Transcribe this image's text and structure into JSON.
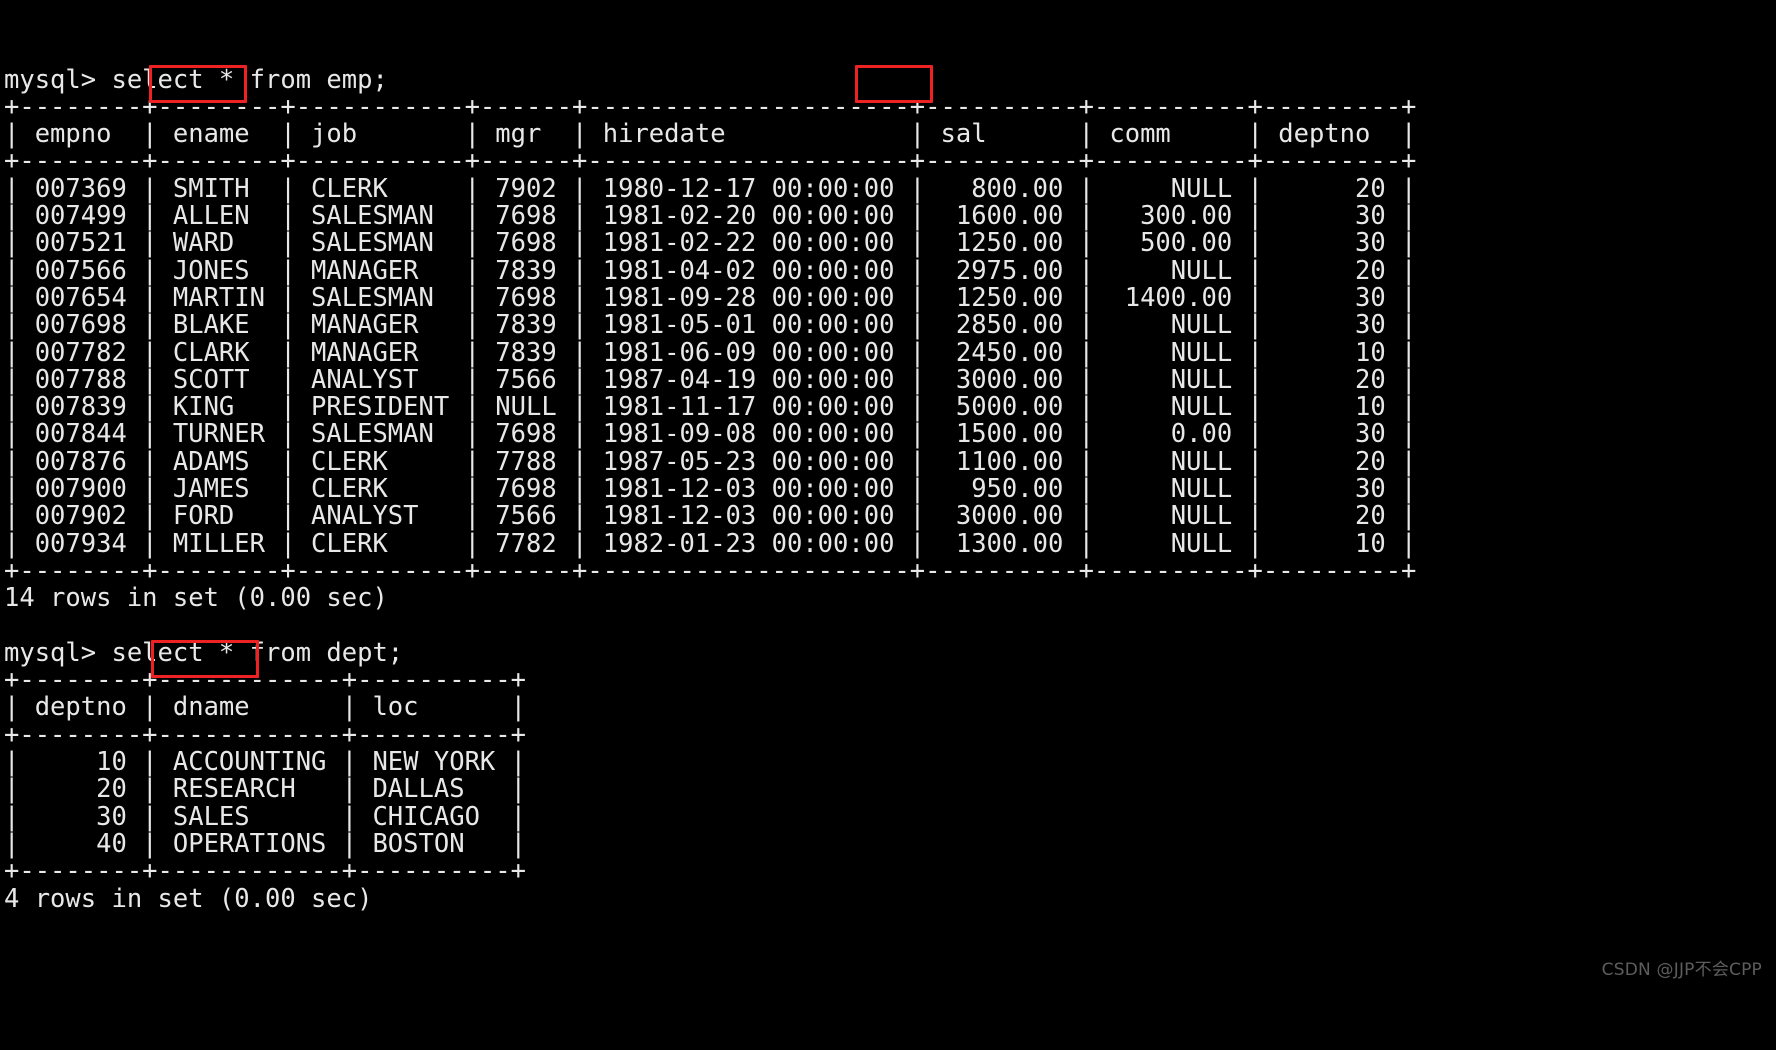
{
  "terminal": {
    "prompt": "mysql>",
    "colors": {
      "background": "#000000",
      "foreground": "#e8e8e8",
      "highlight_box": "#ee2222",
      "watermark": "#5d5d5d"
    }
  },
  "watermark": "CSDN @JJP不会CPP",
  "queries": [
    {
      "command": "mysql> select * from emp;",
      "table": {
        "name": "emp",
        "columns": [
          "empno",
          "ename",
          "job",
          "mgr",
          "hiredate",
          "sal",
          "comm",
          "deptno"
        ],
        "widths": [
          8,
          8,
          11,
          6,
          21,
          10,
          10,
          9
        ],
        "aligns": [
          "right",
          "left",
          "left",
          "right",
          "left",
          "right",
          "right",
          "right"
        ],
        "highlighted_columns": [
          "ename",
          "sal"
        ],
        "rows": [
          [
            "007369",
            "SMITH",
            "CLERK",
            "7902",
            "1980-12-17 00:00:00",
            "800.00",
            "NULL",
            "20"
          ],
          [
            "007499",
            "ALLEN",
            "SALESMAN",
            "7698",
            "1981-02-20 00:00:00",
            "1600.00",
            "300.00",
            "30"
          ],
          [
            "007521",
            "WARD",
            "SALESMAN",
            "7698",
            "1981-02-22 00:00:00",
            "1250.00",
            "500.00",
            "30"
          ],
          [
            "007566",
            "JONES",
            "MANAGER",
            "7839",
            "1981-04-02 00:00:00",
            "2975.00",
            "NULL",
            "20"
          ],
          [
            "007654",
            "MARTIN",
            "SALESMAN",
            "7698",
            "1981-09-28 00:00:00",
            "1250.00",
            "1400.00",
            "30"
          ],
          [
            "007698",
            "BLAKE",
            "MANAGER",
            "7839",
            "1981-05-01 00:00:00",
            "2850.00",
            "NULL",
            "30"
          ],
          [
            "007782",
            "CLARK",
            "MANAGER",
            "7839",
            "1981-06-09 00:00:00",
            "2450.00",
            "NULL",
            "10"
          ],
          [
            "007788",
            "SCOTT",
            "ANALYST",
            "7566",
            "1987-04-19 00:00:00",
            "3000.00",
            "NULL",
            "20"
          ],
          [
            "007839",
            "KING",
            "PRESIDENT",
            "NULL",
            "1981-11-17 00:00:00",
            "5000.00",
            "NULL",
            "10"
          ],
          [
            "007844",
            "TURNER",
            "SALESMAN",
            "7698",
            "1981-09-08 00:00:00",
            "1500.00",
            "0.00",
            "30"
          ],
          [
            "007876",
            "ADAMS",
            "CLERK",
            "7788",
            "1987-05-23 00:00:00",
            "1100.00",
            "NULL",
            "20"
          ],
          [
            "007900",
            "JAMES",
            "CLERK",
            "7698",
            "1981-12-03 00:00:00",
            "950.00",
            "NULL",
            "30"
          ],
          [
            "007902",
            "FORD",
            "ANALYST",
            "7566",
            "1981-12-03 00:00:00",
            "3000.00",
            "NULL",
            "20"
          ],
          [
            "007934",
            "MILLER",
            "CLERK",
            "7782",
            "1982-01-23 00:00:00",
            "1300.00",
            "NULL",
            "10"
          ]
        ]
      },
      "result_status": "14 rows in set (0.00 sec)"
    },
    {
      "command": "mysql> select * from dept;",
      "table": {
        "name": "dept",
        "columns": [
          "deptno",
          "dname",
          "loc"
        ],
        "widths": [
          8,
          12,
          10
        ],
        "aligns": [
          "right",
          "left",
          "left"
        ],
        "highlighted_columns": [
          "dname"
        ],
        "rows": [
          [
            "10",
            "ACCOUNTING",
            "NEW YORK"
          ],
          [
            "20",
            "RESEARCH",
            "DALLAS"
          ],
          [
            "30",
            "SALES",
            "CHICAGO"
          ],
          [
            "40",
            "OPERATIONS",
            "BOSTON"
          ]
        ]
      },
      "result_status": "4 rows in set (0.00 sec)"
    }
  ]
}
